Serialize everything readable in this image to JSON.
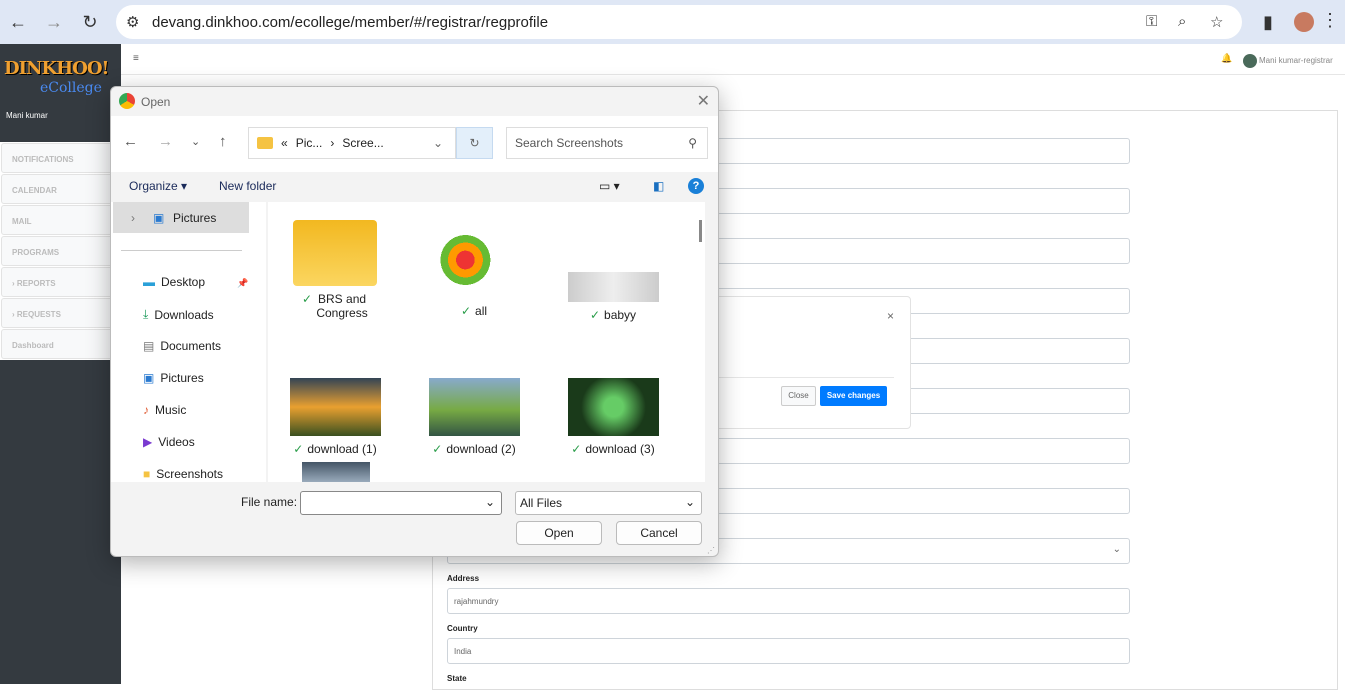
{
  "browser": {
    "url": "devang.dinkhoo.com/ecollege/member/#/registrar/regprofile"
  },
  "app": {
    "logo": "DINKHOO!",
    "logo_sub": "eCollege",
    "user": "Mani kumar",
    "header_user": "Mani kumar-registrar",
    "menu": [
      "NOTIFICATIONS",
      "CALENDAR",
      "MAIL",
      "PROGRAMS",
      "REPORTS",
      "REQUESTS",
      "Dashboard"
    ]
  },
  "form": {
    "address_label": "Address",
    "address_value": "rajahmundry",
    "country_label": "Country",
    "country_value": "India",
    "state_label": "State"
  },
  "modal": {
    "close": "Close",
    "save": "Save changes"
  },
  "dialog": {
    "title": "Open",
    "path": [
      "Pic...",
      "Scree..."
    ],
    "search_placeholder": "Search Screenshots",
    "organize": "Organize",
    "new_folder": "New folder",
    "nav": [
      "Pictures",
      "Desktop",
      "Downloads",
      "Documents",
      "Pictures",
      "Music",
      "Videos",
      "Screenshots"
    ],
    "files": [
      {
        "name": "BRS and Congress"
      },
      {
        "name": "all"
      },
      {
        "name": "babyy"
      },
      {
        "name": "download (1)"
      },
      {
        "name": "download (2)"
      },
      {
        "name": "download (3)"
      }
    ],
    "file_name_label": "File name:",
    "file_type": "All Files",
    "open": "Open",
    "cancel": "Cancel"
  }
}
